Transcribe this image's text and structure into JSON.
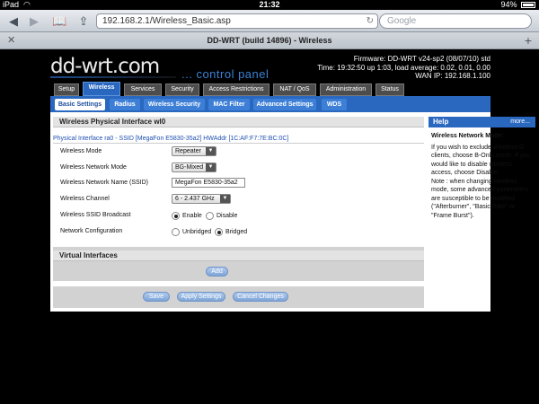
{
  "statusbar": {
    "device": "iPad",
    "time": "21:32",
    "battery": "94%"
  },
  "browser": {
    "url": "192.168.2.1/Wireless_Basic.asp",
    "search_placeholder": "Google",
    "tab_title": "DD-WRT (build 14896) - Wireless"
  },
  "header": {
    "logo": "dd-wrt.com",
    "control_panel": "... control panel",
    "firmware": "Firmware: DD-WRT v24-sp2 (08/07/10) std",
    "uptime": "Time: 19:32:50 up 1:03, load average: 0.02, 0.01, 0.00",
    "wan_ip": "WAN IP: 192.168.1.100"
  },
  "main_tabs": [
    "Setup",
    "Wireless",
    "Services",
    "Security",
    "Access Restrictions",
    "NAT / QoS",
    "Administration",
    "Status"
  ],
  "sub_tabs": [
    "Basic Settings",
    "Radius",
    "Wireless Security",
    "MAC Filter",
    "Advanced Settings",
    "WDS"
  ],
  "section": {
    "title": "Wireless Physical Interface wl0",
    "interface_line": "Physical Interface ra0 - SSID [MegaFon E5830-35a2] HWAddr [1C:AF:F7:7E:BC:0C]"
  },
  "fields": {
    "mode_label": "Wireless Mode",
    "mode_value": "Repeater",
    "netmode_label": "Wireless Network Mode",
    "netmode_value": "BG-Mixed",
    "ssid_label": "Wireless Network Name (SSID)",
    "ssid_value": "MegaFon E5830-35a2",
    "channel_label": "Wireless Channel",
    "channel_value": "6 - 2.437 GHz",
    "broadcast_label": "Wireless SSID Broadcast",
    "broadcast_enable": "Enable",
    "broadcast_disable": "Disable",
    "netconf_label": "Network Configuration",
    "netconf_unbridged": "Unbridged",
    "netconf_bridged": "Bridged"
  },
  "virtual": {
    "title": "Virtual Interfaces",
    "add": "Add"
  },
  "actions": {
    "save": "Save",
    "apply": "Apply Settings",
    "cancel": "Cancel Changes"
  },
  "help": {
    "title": "Help",
    "more": "more...",
    "heading": "Wireless Network Mode:",
    "p1": "If you wish to exclude Wireless-G clients, choose B-Only mode. If you would like to disable wireless access, choose Disable.",
    "note": "Note : when changing wireless mode, some advanced parameters are susceptible to be modified (\"Afterburner\", \"Basic Rate\" or \"Frame Burst\")."
  }
}
